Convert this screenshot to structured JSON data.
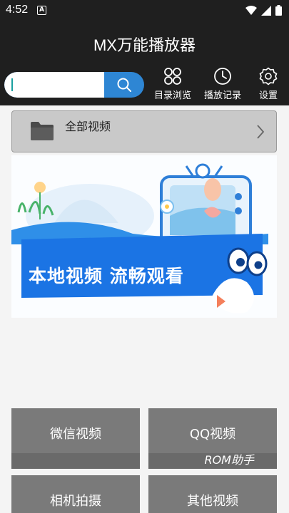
{
  "status_bar": {
    "time": "4:52",
    "notification_badge": "A"
  },
  "app_bar": {
    "title": "MX万能播放器"
  },
  "search": {
    "placeholder": ""
  },
  "nav": {
    "items": [
      {
        "label": "目录浏览",
        "icon": "grid-browse-icon"
      },
      {
        "label": "播放记录",
        "icon": "clock-history-icon"
      },
      {
        "label": "设置",
        "icon": "gear-icon"
      }
    ]
  },
  "all_videos": {
    "label": "全部视频"
  },
  "banner": {
    "text": "本地视频 流畅观看"
  },
  "tiles": [
    {
      "label": "微信视频"
    },
    {
      "label": "QQ视频"
    },
    {
      "label": "相机拍摄"
    },
    {
      "label": "其他视频"
    }
  ],
  "watermark": "ROM助手",
  "colors": {
    "app_bar": "#1f1f1f",
    "search_accent": "#2e86d4",
    "banner_blue": "#1b74e4",
    "tile": "#7a7a7a"
  }
}
